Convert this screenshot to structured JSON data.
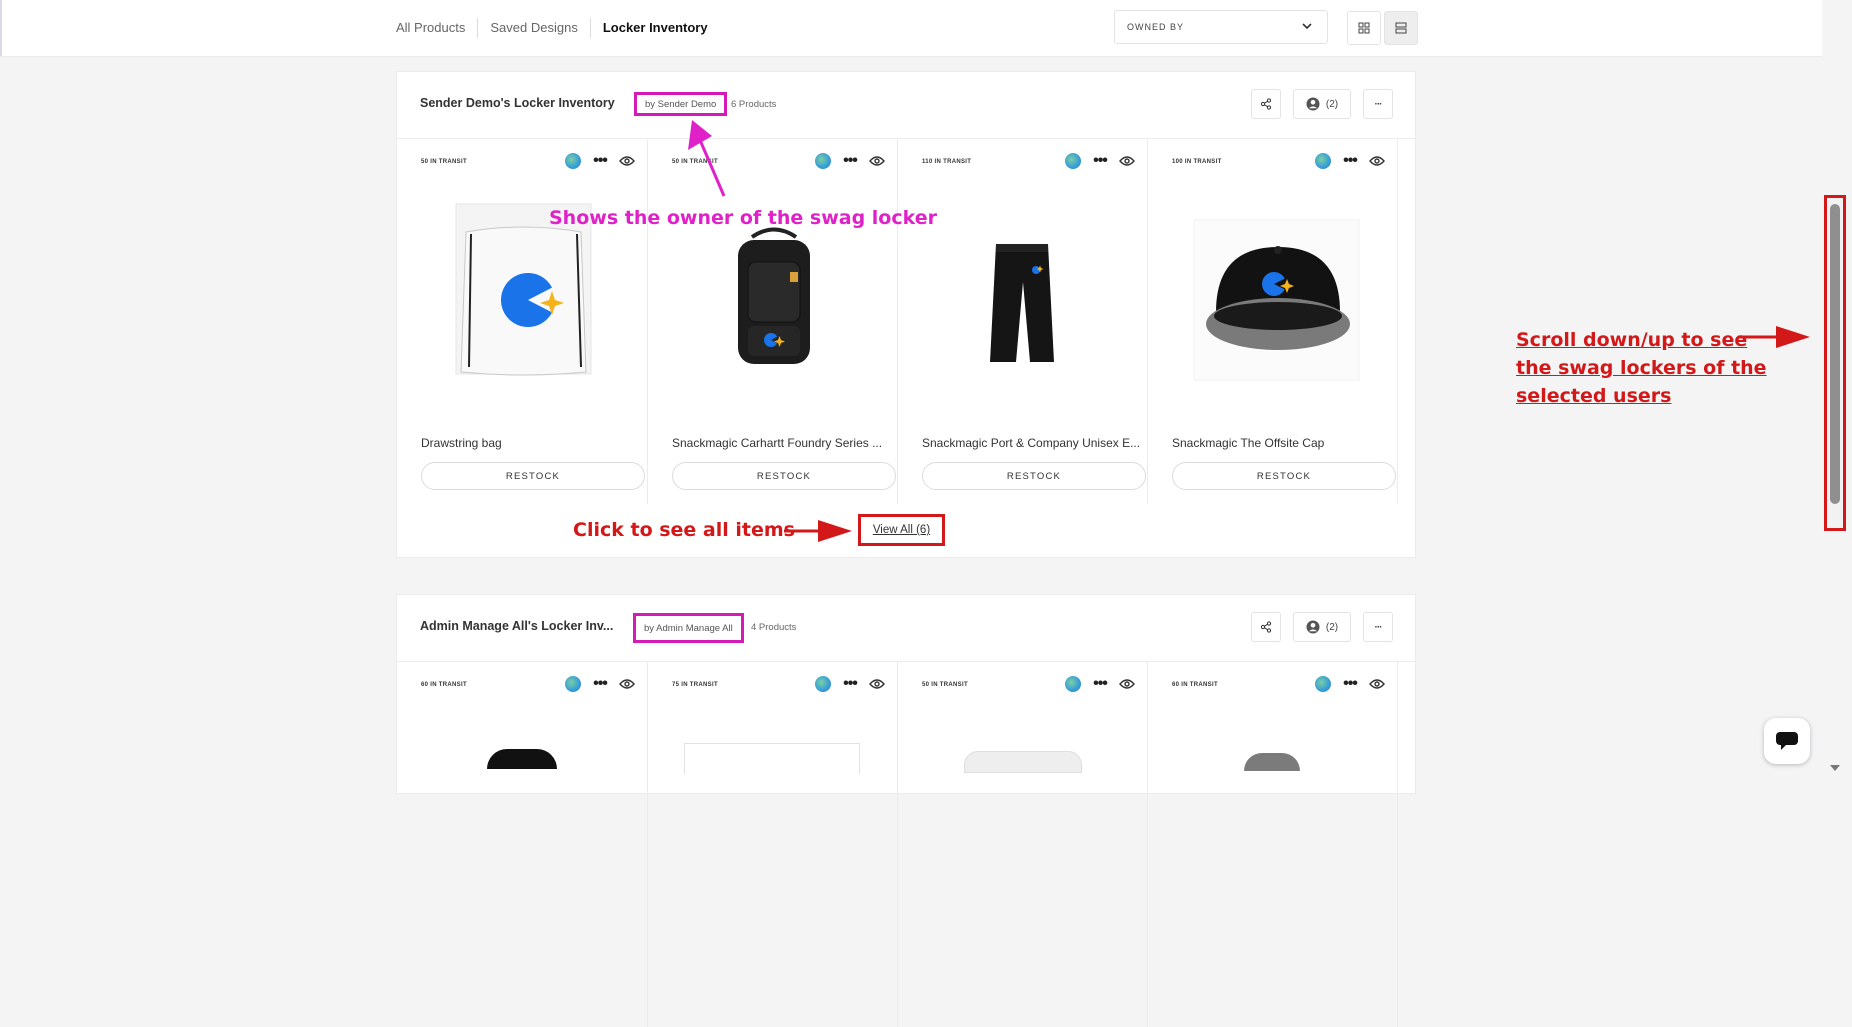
{
  "nav": {
    "tabs": [
      "All Products",
      "Saved Designs",
      "Locker Inventory"
    ],
    "active_tab": "Locker Inventory"
  },
  "filter": {
    "owned_by_label": "OWNED BY"
  },
  "view_modes": [
    "grid-view-icon",
    "list-view-icon"
  ],
  "lockers": [
    {
      "title": "Sender Demo's Locker Inventory",
      "owner": "by Sender Demo",
      "product_count": "6 Products",
      "assigned_users": "(2)",
      "products": [
        {
          "transit": "50 IN TRANSIT",
          "name": "Drawstring bag",
          "action": "RESTOCK"
        },
        {
          "transit": "50 IN TRANSIT",
          "name": "Snackmagic Carhartt Foundry Series ...",
          "action": "RESTOCK"
        },
        {
          "transit": "110 IN TRANSIT",
          "name": "Snackmagic Port & Company Unisex E...",
          "action": "RESTOCK"
        },
        {
          "transit": "100 IN TRANSIT",
          "name": "Snackmagic The Offsite Cap",
          "action": "RESTOCK"
        }
      ],
      "view_all": "View All (6)"
    },
    {
      "title": "Admin Manage All's Locker Inv...",
      "owner": "by Admin Manage All",
      "product_count": "4 Products",
      "assigned_users": "(2)",
      "products": [
        {
          "transit": "60 IN TRANSIT"
        },
        {
          "transit": "75 IN TRANSIT"
        },
        {
          "transit": "50 IN TRANSIT"
        },
        {
          "transit": "60 IN TRANSIT"
        }
      ]
    }
  ],
  "annotations": {
    "owner_note": "Shows the owner of the swag locker",
    "view_all_note": "Click to see all items",
    "scroll_note": [
      "Scroll down/up to see",
      "the swag lockers of the",
      "selected users"
    ]
  },
  "colors": {
    "annotation_pink": "#e020c8",
    "annotation_red": "#d21818",
    "brand_blue": "#1a73e8",
    "brand_star": "#f5b21a"
  }
}
